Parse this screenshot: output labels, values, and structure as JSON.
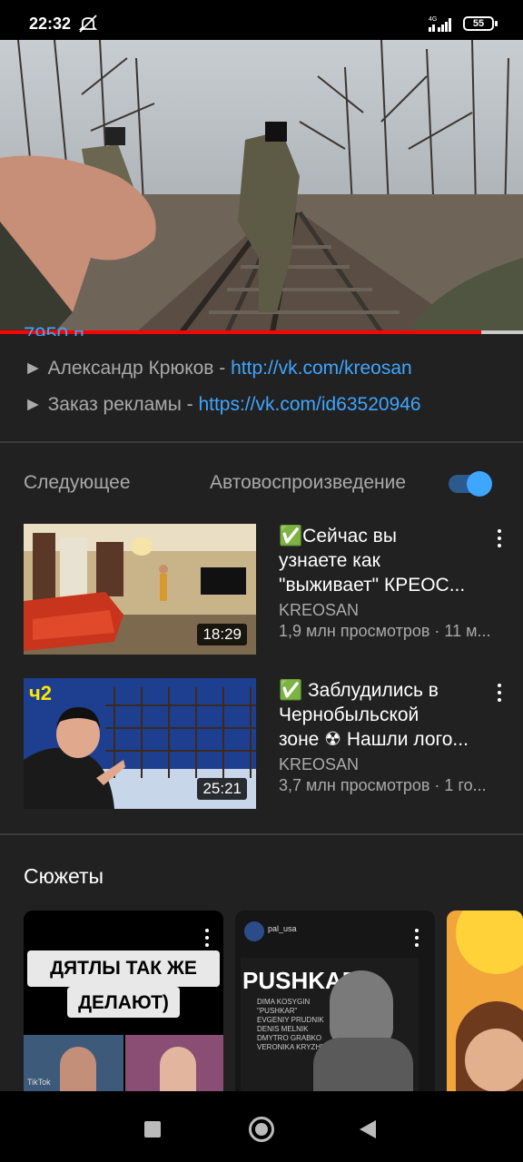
{
  "status_bar": {
    "time": "22:32",
    "network": "4G",
    "battery": "55"
  },
  "player": {
    "progress": 0.92
  },
  "description": {
    "cut_text": "7950 п...",
    "lines": [
      {
        "prefix": "► Александр Крюков - ",
        "link": "http://vk.com/kreosan"
      },
      {
        "prefix": "► Заказ рекламы - ",
        "link": "https://vk.com/id63520946"
      }
    ]
  },
  "up_next": {
    "label": "Следующее",
    "autoplay_label": "Автовоспроизведение",
    "autoplay_on": true
  },
  "videos": [
    {
      "title_lines": [
        "✅Сейчас вы",
        "узнаете как",
        "\"выживает\" КРЕОС..."
      ],
      "channel": "KREOSAN",
      "stats": "1,9 млн просмотров · 11 м...",
      "duration": "18:29"
    },
    {
      "title_lines": [
        "✅ Заблудились в",
        "Чернобыльской",
        "зоне ☢ Нашли лого..."
      ],
      "channel": "KREOSAN",
      "stats": "3,7 млн просмотров · 1 го...",
      "duration": "25:21",
      "badge": "ч2"
    }
  ],
  "shorts": {
    "heading": "Сюжеты",
    "items": [
      {
        "caption_line1": "ДЯТЛЫ ТАК ЖЕ",
        "caption_line2": "ДЕЛАЮТ)",
        "watermark": "TikTok"
      },
      {
        "account": "pal_usa",
        "title": "PUSHKAR",
        "names": [
          "DIMA KOSYGIN",
          "\"PUSHKAR\"",
          "EVGENIY PRUDNIK",
          "DENIS MELNIK",
          "DMYTRO GRABKO",
          "VERONIKA KRYZHNA"
        ]
      },
      {}
    ]
  },
  "colors": {
    "background": "#212121",
    "accent_link": "#3ea6ff",
    "progress": "#ff0000"
  }
}
